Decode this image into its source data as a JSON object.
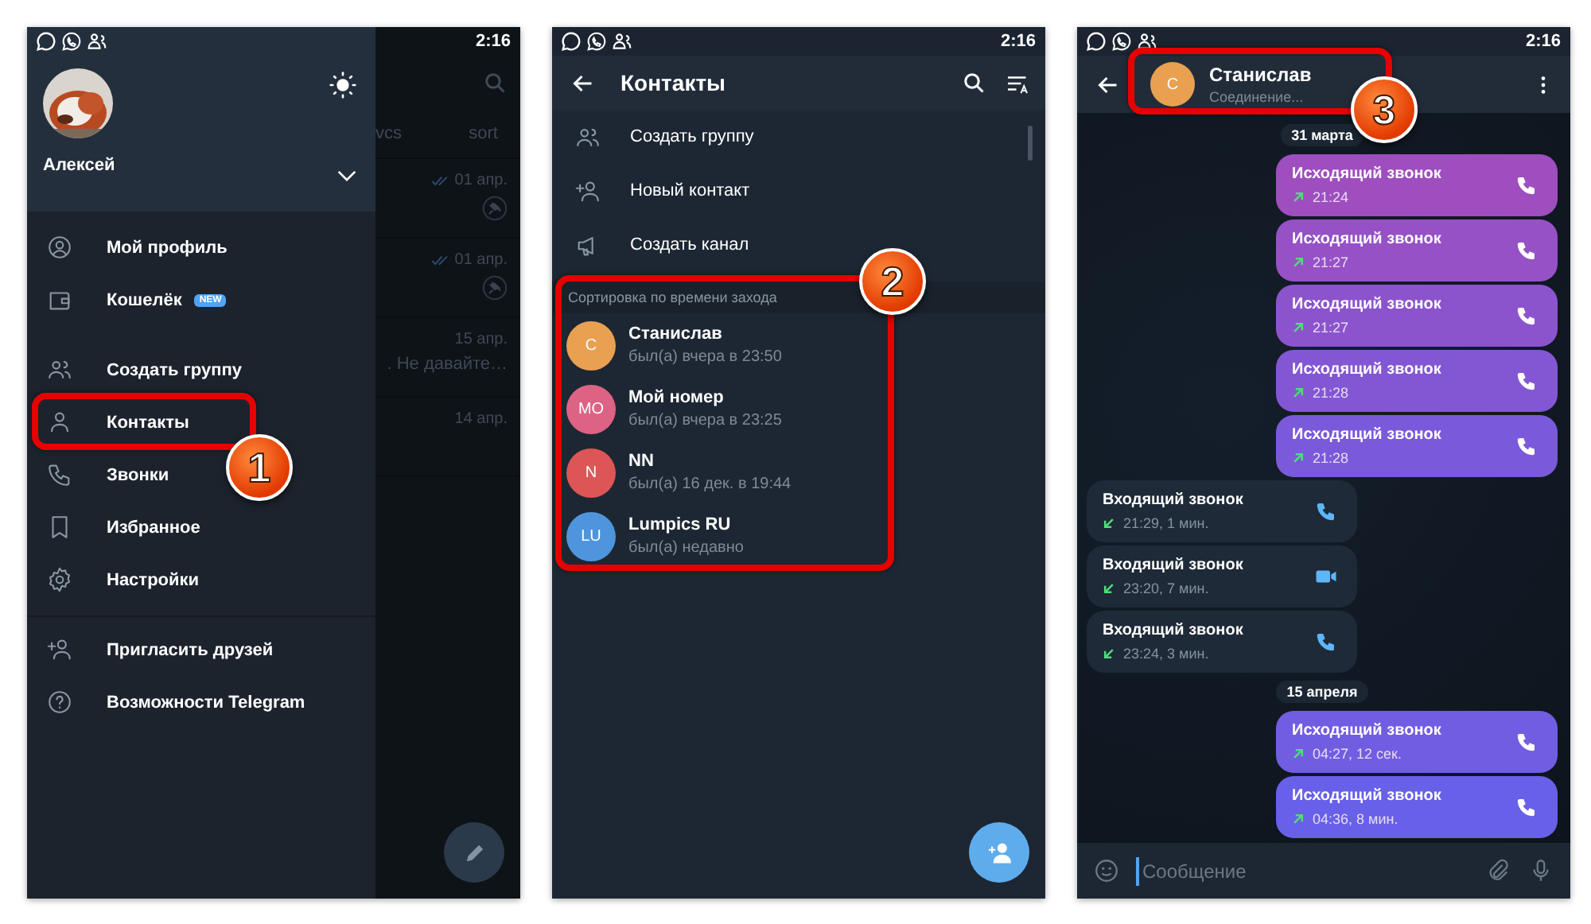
{
  "drawer_screen": {
    "status_bar": {
      "time": "2:16"
    },
    "profile": {
      "name": "Алексей"
    },
    "menu": [
      {
        "kind": "item",
        "label": "Мой профиль"
      },
      {
        "kind": "item",
        "label": "Кошелёк",
        "badge": "NEW"
      },
      {
        "kind": "spacer"
      },
      {
        "kind": "item",
        "label": "Создать группу"
      },
      {
        "kind": "item",
        "label": "Контакты",
        "step": "1"
      },
      {
        "kind": "item",
        "label": "Звонки"
      },
      {
        "kind": "item",
        "label": "Избранное"
      },
      {
        "kind": "item",
        "label": "Настройки"
      },
      {
        "kind": "divider"
      },
      {
        "kind": "item",
        "label": "Пригласить друзей"
      },
      {
        "kind": "item",
        "label": "Возможности Telegram"
      }
    ],
    "background_chats": {
      "tabs": [
        "vcs",
        "sort"
      ],
      "rows": [
        {
          "date": "01 апр.",
          "read": true,
          "pinned": true
        },
        {
          "date": "01 апр.",
          "read": true,
          "pinned": true
        },
        {
          "date": "15 апр.",
          "preview": ". Не давайте…",
          "read": false,
          "pinned": false
        },
        {
          "date": "14 апр.",
          "read": false,
          "pinned": false
        }
      ]
    }
  },
  "contacts_screen": {
    "status_bar": {
      "time": "2:16"
    },
    "title": "Контакты",
    "actions": [
      {
        "label": "Создать группу"
      },
      {
        "label": "Новый контакт"
      },
      {
        "label": "Создать канал"
      }
    ],
    "section_title": "Сортировка по времени захода",
    "contacts": [
      {
        "initials": "С",
        "name": "Станислав",
        "status": "был(а) вчера в 23:50",
        "color": "#e9a050"
      },
      {
        "initials": "MO",
        "name": "Мой номер",
        "status": "был(а) вчера в 23:25",
        "color": "#dc6384"
      },
      {
        "initials": "N",
        "name": "NN",
        "status": "был(а) 16 дек. в 19:44",
        "color": "#dc5656"
      },
      {
        "initials": "LU",
        "name": "Lumpics RU",
        "status": "был(а) недавно",
        "color": "#4f95dd"
      }
    ],
    "callout": "2"
  },
  "chat_screen": {
    "status_bar": {
      "time": "2:16"
    },
    "contact": {
      "initials": "С",
      "name": "Станислав",
      "status": "Соединение...",
      "color": "#e9a050"
    },
    "callout": "3",
    "messages": [
      {
        "kind": "date",
        "text": "31 марта"
      },
      {
        "kind": "outgoing",
        "title": "Исходящий звонок",
        "time": "21:24",
        "video": false
      },
      {
        "kind": "outgoing",
        "title": "Исходящий звонок",
        "time": "21:27",
        "video": false
      },
      {
        "kind": "outgoing",
        "title": "Исходящий звонок",
        "time": "21:27",
        "video": false
      },
      {
        "kind": "outgoing",
        "title": "Исходящий звонок",
        "time": "21:28",
        "video": false
      },
      {
        "kind": "outgoing",
        "title": "Исходящий звонок",
        "time": "21:28",
        "video": false
      },
      {
        "kind": "incoming",
        "title": "Входящий звонок",
        "time": "21:29, 1 мин.",
        "video": false
      },
      {
        "kind": "incoming",
        "title": "Входящий звонок",
        "time": "23:20, 7 мин.",
        "video": true
      },
      {
        "kind": "incoming",
        "title": "Входящий звонок",
        "time": "23:24, 3 мин.",
        "video": false
      },
      {
        "kind": "date",
        "text": "15 апреля"
      },
      {
        "kind": "outgoing",
        "title": "Исходящий звонок",
        "time": "04:27, 12 сек.",
        "video": false
      },
      {
        "kind": "outgoing",
        "title": "Исходящий звонок",
        "time": "04:36, 8 мин.",
        "video": false
      }
    ],
    "composer": {
      "placeholder": "Сообщение"
    }
  }
}
